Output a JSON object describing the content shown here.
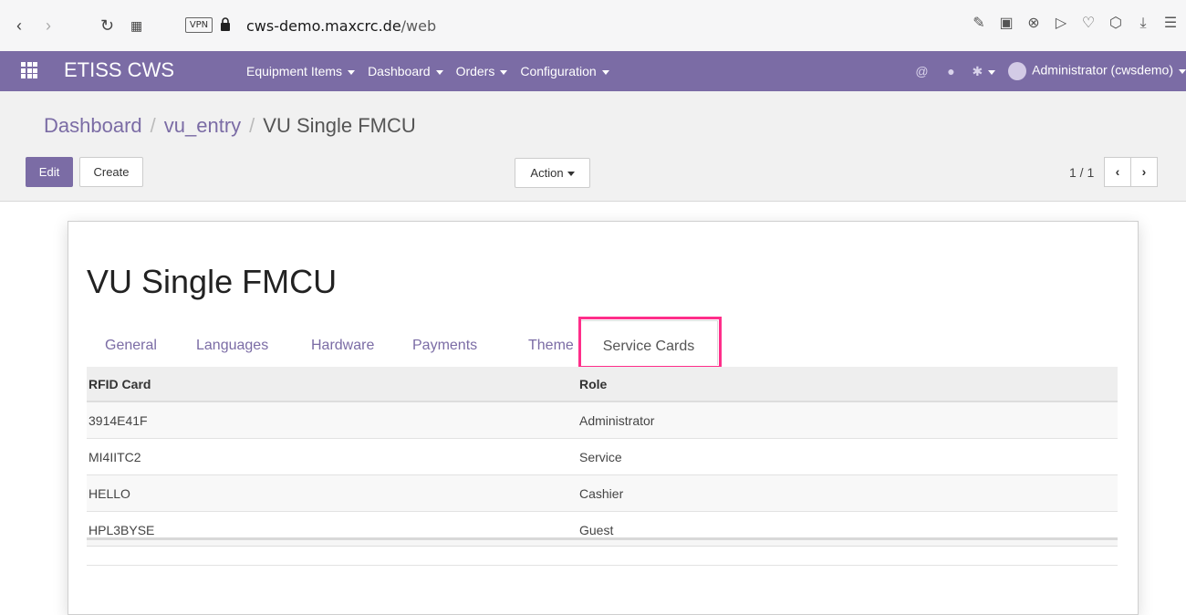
{
  "browser": {
    "vpn_label": "VPN",
    "url_host": "cws-demo.maxcrc.de",
    "url_path": "/web",
    "icons": [
      "back-icon",
      "forward-icon",
      "reload-icon",
      "tabs-grid-icon",
      "edit-page-icon",
      "camera-icon",
      "close-circle-icon",
      "send-icon",
      "heart-icon",
      "box-icon",
      "download-icon",
      "settings-sliders-icon"
    ]
  },
  "navbar": {
    "brand": "ETISS CWS",
    "menu": [
      "Equipment Items",
      "Dashboard",
      "Orders",
      "Configuration"
    ],
    "user": "Administrator (cwsdemo)",
    "color": "#7b6ca5"
  },
  "breadcrumb": {
    "items": [
      "Dashboard",
      "vu_entry"
    ],
    "separator": "/",
    "current": "VU Single FMCU"
  },
  "toolbar": {
    "edit_label": "Edit",
    "create_label": "Create",
    "action_label": "Action",
    "pager_value": "1 / 1"
  },
  "record": {
    "title": "VU Single FMCU",
    "tabs": [
      "General",
      "Languages",
      "Hardware",
      "Payments",
      "Theme",
      "Service Cards"
    ],
    "active_tab": "Service Cards",
    "table": {
      "headers": [
        "RFID Card",
        "Role"
      ],
      "rows": [
        [
          "3914E41F",
          "Administrator"
        ],
        [
          "MI4IITC2",
          "Service"
        ],
        [
          "HELLO",
          "Cashier"
        ],
        [
          "HPL3BYSE",
          "Guest"
        ]
      ]
    },
    "highlight_color": "#ff2e8a"
  }
}
